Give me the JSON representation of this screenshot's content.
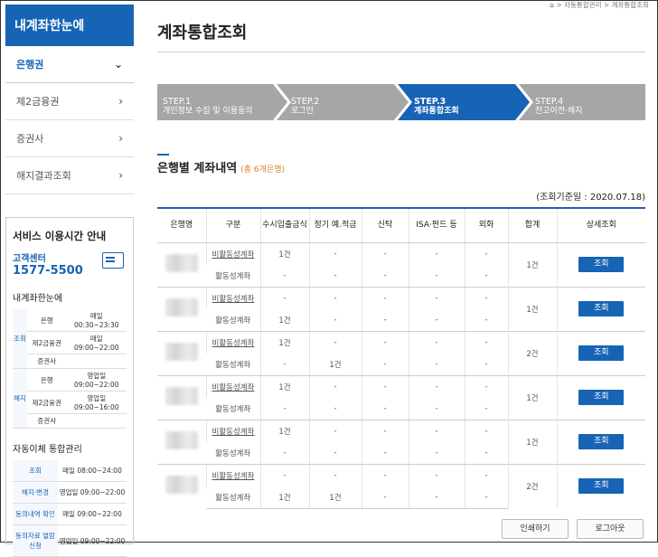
{
  "sidebar": {
    "title": "내계좌한눈에",
    "items": [
      {
        "label": "은행권",
        "active": true
      },
      {
        "label": "제2금융권",
        "active": false
      },
      {
        "label": "증권사",
        "active": false
      },
      {
        "label": "해지결과조회",
        "active": false
      }
    ]
  },
  "service": {
    "title": "서비스 이용시간 안내",
    "center_label": "고객센터",
    "phone": "1577-5500",
    "section1": "내계좌한눈에",
    "section2": "자동이체 통합관리",
    "rows": [
      {
        "cat": "조회",
        "org": "은행",
        "time1": "매일",
        "time2": "00:30~23:30"
      },
      {
        "cat": "",
        "org": "제2금융권",
        "time1": "매일",
        "time2": "09:00~22:00"
      },
      {
        "cat": "",
        "org": "증권사",
        "time1": "",
        "time2": ""
      },
      {
        "cat": "해지",
        "org": "은행",
        "time1": "영업일",
        "time2": "09:00~22:00"
      },
      {
        "cat": "",
        "org": "제2금융권",
        "time1": "영업일",
        "time2": "09:00~16:00"
      },
      {
        "cat": "",
        "org": "증권사",
        "time1": "",
        "time2": ""
      }
    ],
    "auto_rows": [
      {
        "k": "조회",
        "v": "매일 08:00~24:00"
      },
      {
        "k": "해지·변경",
        "v": "영업일 09:00~22:00"
      },
      {
        "k": "동의내역 확인",
        "v": "매일 09:00~22:00"
      },
      {
        "k": "동의자료 열람신청",
        "v": "영업일 09:00~22:00"
      }
    ]
  },
  "breadcrumb": {
    "home": "⌂",
    "path": "> 자동통합관리 >",
    "current": "계좌통합조회"
  },
  "page_title": "계좌통합조회",
  "steps": [
    {
      "num": "STEP.1",
      "label": "개인정보 수집 및 이용동의"
    },
    {
      "num": "STEP.2",
      "label": "로그인"
    },
    {
      "num": "STEP.3",
      "label": "계좌통합조회"
    },
    {
      "num": "STEP.4",
      "label": "잔고이전·해지"
    }
  ],
  "section": {
    "title": "은행별 계좌내역",
    "count": "(총 6개은행)",
    "ref_date": "(조회기준일 : 2020.07.18)"
  },
  "table": {
    "headers": [
      "은행명",
      "구분",
      "수시입출금식",
      "정기 예.적금",
      "신탁",
      "ISA·펀드 등",
      "외화",
      "합계",
      "상세조회"
    ],
    "type_inactive": "비활동성계좌",
    "type_active": "활동성계좌",
    "detail_label": "조회",
    "banks": [
      {
        "inactive": [
          "1건",
          "-",
          "-",
          "-",
          "-"
        ],
        "active": [
          "-",
          "-",
          "-",
          "-",
          "-"
        ],
        "total": "1건"
      },
      {
        "inactive": [
          "-",
          "-",
          "-",
          "-",
          "-"
        ],
        "active": [
          "1건",
          "-",
          "-",
          "-",
          "-"
        ],
        "total": "1건"
      },
      {
        "inactive": [
          "1건",
          "-",
          "-",
          "-",
          "-"
        ],
        "active": [
          "-",
          "1건",
          "-",
          "-",
          "-"
        ],
        "total": "2건"
      },
      {
        "inactive": [
          "1건",
          "-",
          "-",
          "-",
          "-"
        ],
        "active": [
          "-",
          "-",
          "-",
          "-",
          "-"
        ],
        "total": "1건"
      },
      {
        "inactive": [
          "1건",
          "-",
          "-",
          "-",
          "-"
        ],
        "active": [
          "-",
          "-",
          "-",
          "-",
          "-"
        ],
        "total": "1건"
      },
      {
        "inactive": [
          "-",
          "-",
          "-",
          "-",
          "-"
        ],
        "active": [
          "1건",
          "1건",
          "-",
          "-",
          "-"
        ],
        "total": "2건"
      }
    ]
  },
  "buttons": {
    "print": "인쇄하기",
    "logout": "로그아웃"
  },
  "colors": {
    "primary": "#1763b5",
    "step_inactive": "#a6a6a6",
    "count_orange": "#d9822b"
  }
}
